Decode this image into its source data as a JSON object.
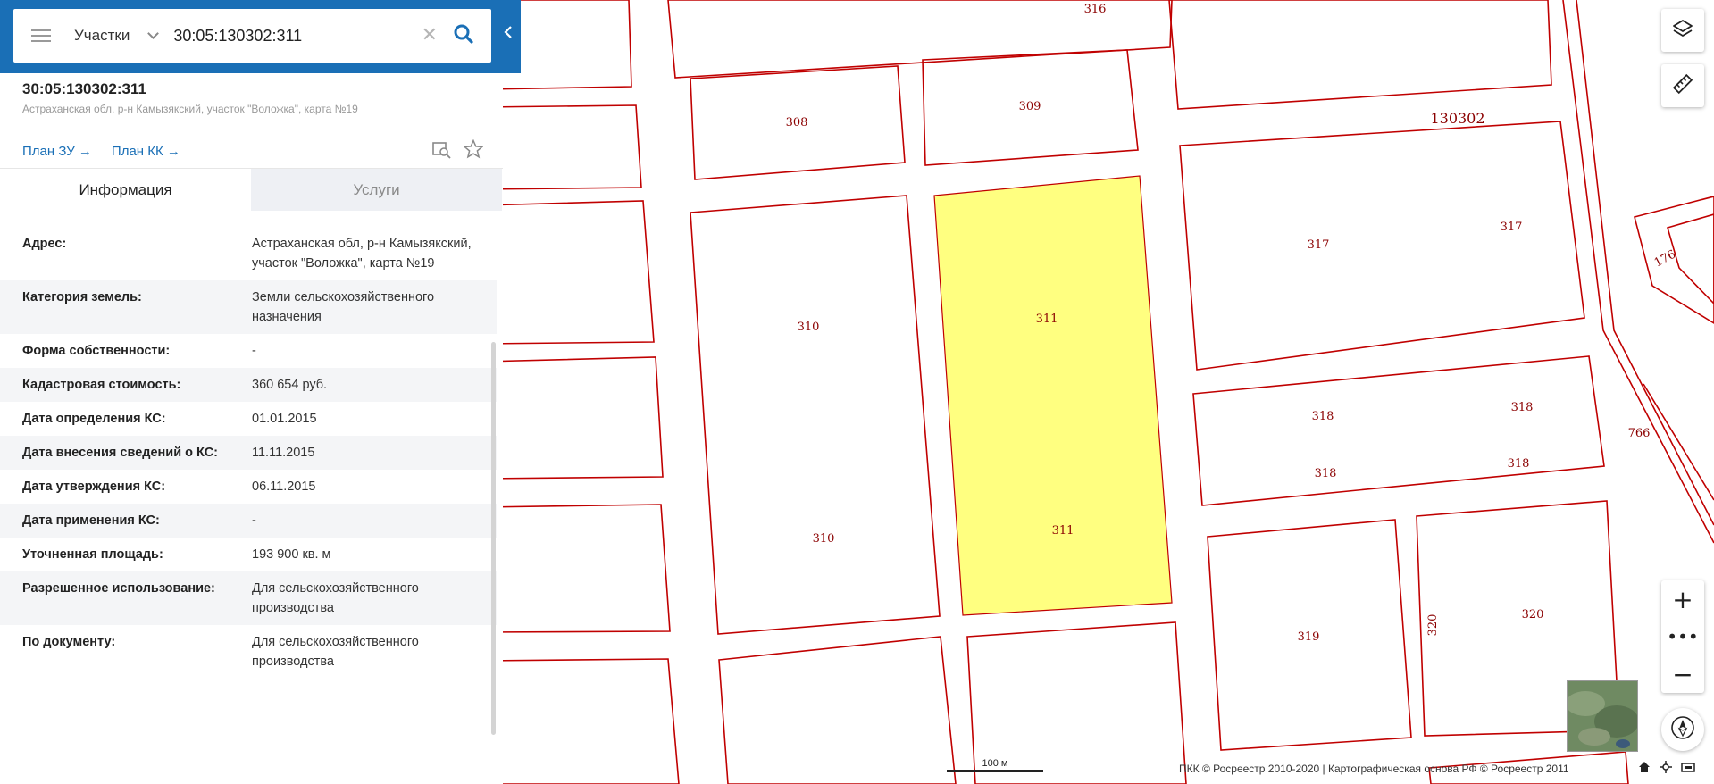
{
  "search": {
    "type_label": "Участки",
    "query": "30:05:130302:311"
  },
  "object": {
    "cadastral_number": "30:05:130302:311",
    "address_short": "Астраханская обл, р-н Камызякский, участок \"Воложка\", карта №19",
    "link_zu": "План ЗУ →",
    "link_kk": "План КК →"
  },
  "tabs": [
    {
      "label": "Информация",
      "active": true
    },
    {
      "label": "Услуги",
      "active": false
    }
  ],
  "info_rows": [
    {
      "key": "Адрес:",
      "value": "Астраханская обл, р-н Камызякский, участок \"Воложка\", карта №19"
    },
    {
      "key": "Категория земель:",
      "value": "Земли сельскохозяйственного назначения"
    },
    {
      "key": "Форма собственности:",
      "value": "-"
    },
    {
      "key": "Кадастровая стоимость:",
      "value": "360 654 руб."
    },
    {
      "key": "Дата определения КС:",
      "value": "01.01.2015"
    },
    {
      "key": "Дата внесения сведений о КС:",
      "value": "11.11.2015"
    },
    {
      "key": "Дата утверждения КС:",
      "value": "06.11.2015"
    },
    {
      "key": "Дата применения КС:",
      "value": "-"
    },
    {
      "key": "Уточненная площадь:",
      "value": "193 900 кв. м"
    },
    {
      "key": "Разрешенное использование:",
      "value": "Для сельскохозяйственного производства"
    },
    {
      "key": "По документу:",
      "value": "Для сельскохозяйственного производства"
    }
  ],
  "map": {
    "block_label": "130302",
    "plot_labels": [
      "316",
      "308",
      "309",
      "317",
      "317",
      "176",
      "311",
      "311",
      "310",
      "310",
      "318",
      "318",
      "318",
      "318",
      "766",
      "319",
      "320",
      "320"
    ],
    "selected_plot": "311",
    "highlight_color": "#ffff80",
    "boundary_color": "#c00000",
    "scale_label": "100 м",
    "attribution": "ПКК © Росреестр 2010-2020 | Картографическая основа РФ © Росреестр 2011"
  },
  "icons": [
    "menu-icon",
    "chevron-down-icon",
    "clear-icon",
    "search-icon",
    "collapse-icon",
    "zoom-plot-icon",
    "favorite-star-icon",
    "layers-icon",
    "ruler-icon",
    "zoom-in-icon",
    "more-icon",
    "zoom-out-icon",
    "compass-icon",
    "home-icon",
    "locate-icon",
    "print-icon"
  ]
}
